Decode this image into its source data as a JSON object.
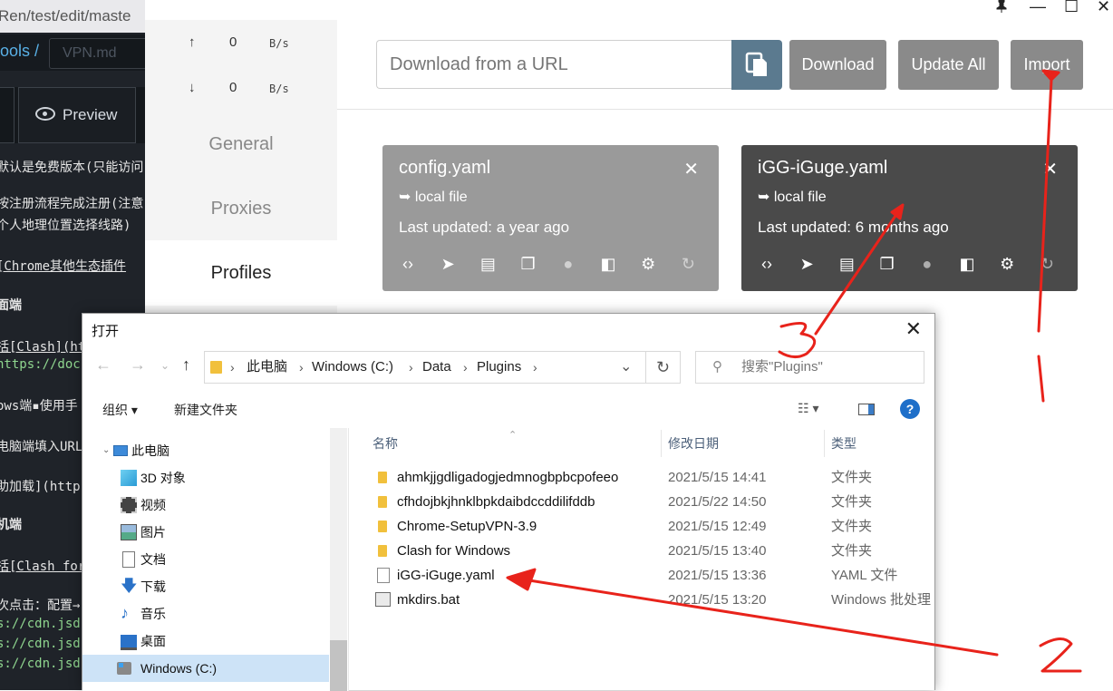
{
  "editor": {
    "url_fragment": "Ren/test/edit/maste",
    "path_fragment": "ools /",
    "file_name_placeholder": "VPN.md",
    "preview_label": "Preview",
    "lines": [
      "默认是免费版本(只能访问",
      "按注册流程完成注册(注意",
      "个人地理位置选择线路)",
      "[Chrome其他生态插件",
      "面端",
      "括[Clash](ht",
      "https://docs",
      "ows端▪使用手",
      "电脑端填入URL",
      "助加载](https",
      "机端",
      "括[Clash for",
      "次点击：配置→",
      "s://cdn.jsd",
      "s://cdn.jsd",
      "s://cdn.jsd"
    ]
  },
  "clash": {
    "titlebar": {
      "pin": "pin-icon",
      "minimize": "—",
      "maximize": "☐",
      "close": "✕"
    },
    "traffic": {
      "up_arrow": "↑",
      "up_value": "0",
      "up_unit": "B/s",
      "down_arrow": "↓",
      "down_value": "0",
      "down_unit": "B/s"
    },
    "nav": [
      {
        "label": "General"
      },
      {
        "label": "Proxies"
      },
      {
        "label": "Profiles"
      }
    ],
    "toolbar": {
      "url_placeholder": "Download from a URL",
      "download_label": "Download",
      "update_all_label": "Update All",
      "import_label": "Import"
    },
    "profiles": [
      {
        "name": "config.yaml",
        "type": "➥ local file",
        "updated": "Last updated: a year ago",
        "bg": "#9a9a9a",
        "close": "✕"
      },
      {
        "name": "iGG-iGuge.yaml",
        "type": "➥ local file",
        "updated": "Last updated: 6 months ago",
        "bg": "#4a4a4a",
        "close": "✕"
      }
    ],
    "card_icons": [
      "code-icon",
      "send-icon",
      "list-icon",
      "copy-icon",
      "globe-icon",
      "compare-icon",
      "gear-icon",
      "refresh-icon"
    ]
  },
  "dialog": {
    "title": "打开",
    "close": "✕",
    "breadcrumbs": [
      "此电脑",
      "Windows (C:)",
      "Data",
      "Plugins"
    ],
    "search_placeholder": "搜索\"Plugins\"",
    "organize_label": "组织 ▾",
    "new_folder_label": "新建文件夹",
    "tree": [
      {
        "label": "此电脑",
        "icon": "computer-icon"
      },
      {
        "label": "3D 对象",
        "icon": "cube-icon"
      },
      {
        "label": "视频",
        "icon": "video-icon"
      },
      {
        "label": "图片",
        "icon": "picture-icon"
      },
      {
        "label": "文档",
        "icon": "document-icon"
      },
      {
        "label": "下载",
        "icon": "download-icon"
      },
      {
        "label": "音乐",
        "icon": "music-icon"
      },
      {
        "label": "桌面",
        "icon": "desktop-icon"
      },
      {
        "label": "Windows (C:)",
        "icon": "drive-icon"
      }
    ],
    "columns": [
      "名称",
      "修改日期",
      "类型"
    ],
    "files": [
      {
        "name": "ahmkjjgdligadogjedmnogbpbcpofeeo",
        "date": "2021/5/15 14:41",
        "type": "文件夹",
        "kind": "folder"
      },
      {
        "name": "cfhdojbkjhnklbpkdaibdccddilifddb",
        "date": "2021/5/22 14:50",
        "type": "文件夹",
        "kind": "folder"
      },
      {
        "name": "Chrome-SetupVPN-3.9",
        "date": "2021/5/15 12:49",
        "type": "文件夹",
        "kind": "folder"
      },
      {
        "name": "Clash for Windows",
        "date": "2021/5/15 13:40",
        "type": "文件夹",
        "kind": "folder"
      },
      {
        "name": "iGG-iGuge.yaml",
        "date": "2021/5/15 13:36",
        "type": "YAML 文件",
        "kind": "file"
      },
      {
        "name": "mkdirs.bat",
        "date": "2021/5/15 13:20",
        "type": "Windows 批处理",
        "kind": "bat"
      }
    ]
  },
  "annotations": {
    "color": "#e8231b",
    "labels": [
      "1",
      "2",
      "3"
    ]
  }
}
